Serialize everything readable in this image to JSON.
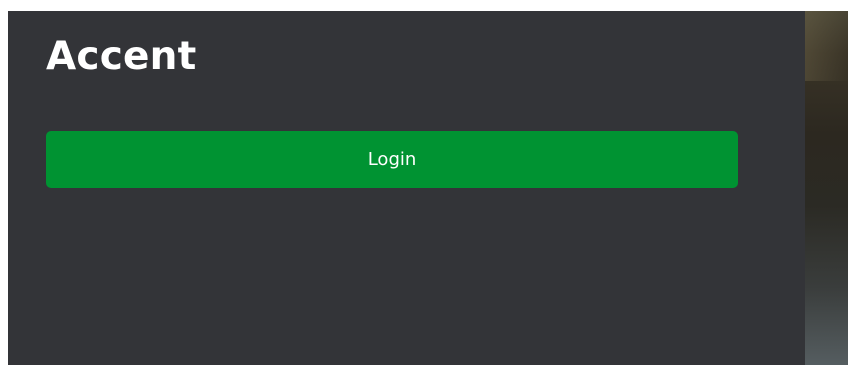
{
  "header": {
    "title": "Accent"
  },
  "login": {
    "button_label": "Login"
  },
  "colors": {
    "panel_background": "#333438",
    "accent": "#009332",
    "text": "#ffffff"
  }
}
